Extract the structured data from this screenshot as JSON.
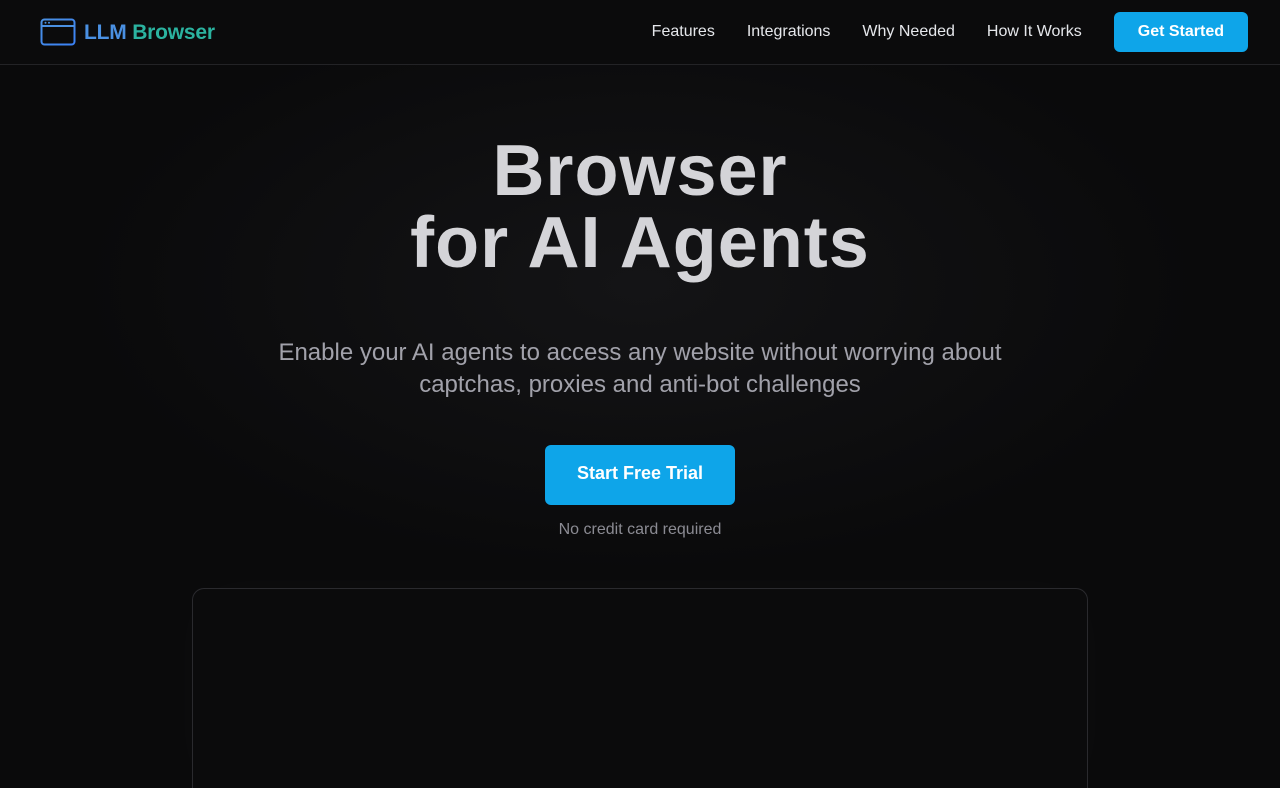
{
  "brand": {
    "name_part1": "LLM",
    "name_part2": "Browser",
    "icon": "browser-window-icon",
    "colors": {
      "part1": "#4a90e2",
      "part2": "#2bb3a0"
    }
  },
  "nav": {
    "links": [
      "Features",
      "Integrations",
      "Why Needed",
      "How It Works"
    ],
    "cta_label": "Get Started"
  },
  "hero": {
    "title_line1": "Browser",
    "title_line2": "for AI Agents",
    "subtitle": "Enable your AI agents to access any website without worrying about captchas, proxies and anti-bot challenges",
    "cta_label": "Start Free Trial",
    "note": "No credit card required"
  },
  "colors": {
    "accent": "#0ea5e9",
    "background": "#0a0a0b"
  }
}
